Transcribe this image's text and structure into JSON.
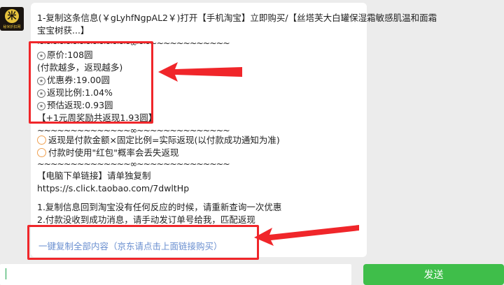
{
  "avatar": {
    "glyph": "米",
    "caption": "秘米折扣网"
  },
  "message": {
    "line1": "1-复制这条信息(￥gLyhfNgpAL2￥)打开【手机淘宝】立即购买/【丝塔芙大白罐保湿霜敏感肌温和面霜",
    "line2": "宝宝树获...】",
    "sep1": "~~~~~~~~~~~~~~∞~~~~~~~~~~~~~~",
    "original_price": "原价:108圆",
    "note": "(付款越多，返现越多)",
    "coupon": "优惠券:19.00圆",
    "rebate_ratio": "返现比例:1.04%",
    "estimated_rebate": "预估返现:0.93圆",
    "weekly_bonus": "【+1元周奖励共返现1.93圆】",
    "sep2": "~~~~~~~~~~~~~~∞~~~~~~~~~~~~~~",
    "rule1": "返现是付款金额×固定比例=实际返现(以付款成功通知为准)",
    "rule2": "付款时使用\"红包\"概率会丢失返现",
    "sep3": "~~~~~~~~~~~~~~∞~~~~~~~~~~~~~~",
    "pc_link_label": "【电脑下单链接】请单独复制",
    "url": "https://s.click.taobao.com/7dwltHp",
    "tip1": "1.复制信息回到淘宝没有任何反应的时候，请重新查询一次优惠",
    "tip2": "2.付款没收到成功消息，请手动发订单号给我，匹配返现",
    "copy_all": "一键复制全部内容（京东请点击上面链接购买）"
  },
  "colors": {
    "highlight": "#f0262a",
    "send": "#3fbe4a",
    "link": "#6a8fd0"
  },
  "input": {
    "value": ""
  },
  "send_label": "发送"
}
